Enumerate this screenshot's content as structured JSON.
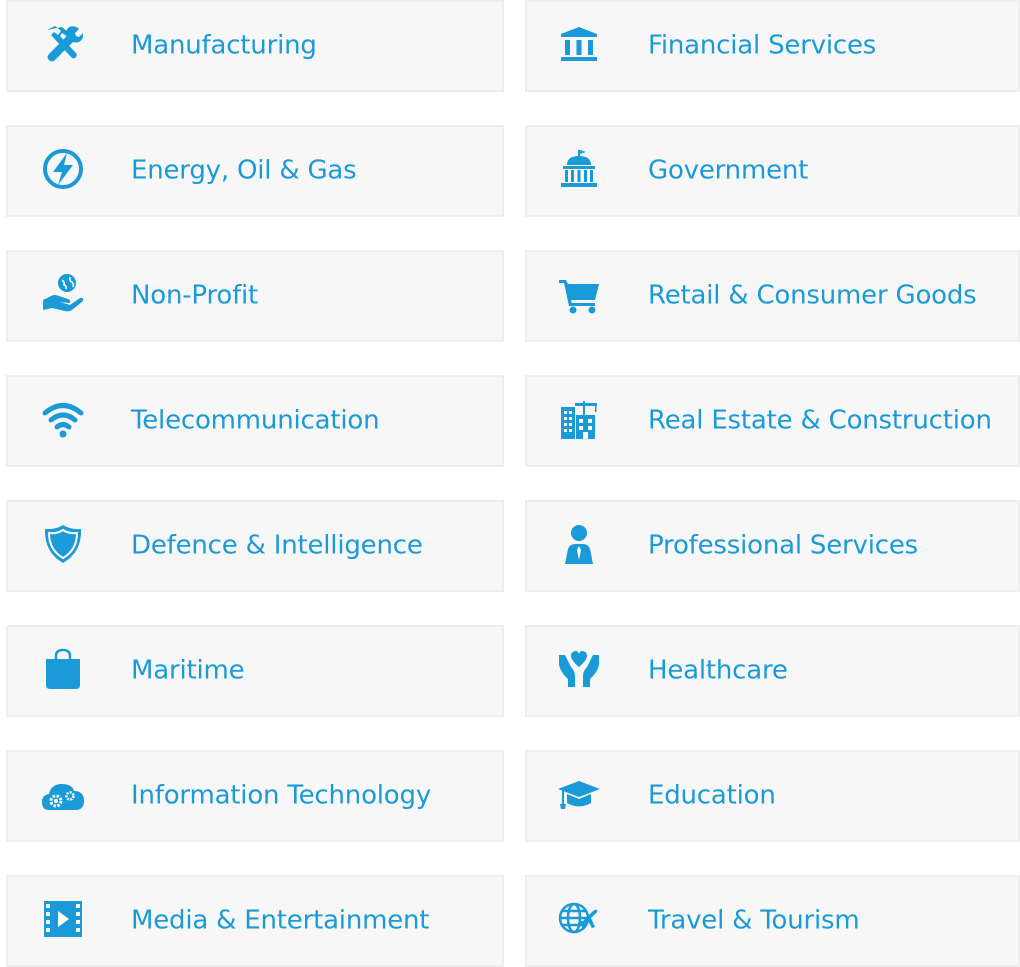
{
  "accent_color": "#1a9ad6",
  "card_background": "#f7f7f7",
  "industries": [
    {
      "label": "Manufacturing",
      "icon": "tools-icon"
    },
    {
      "label": "Financial Services",
      "icon": "bank-icon"
    },
    {
      "label": "Energy, Oil & Gas",
      "icon": "lightning-icon"
    },
    {
      "label": "Government",
      "icon": "government-building-icon"
    },
    {
      "label": "Non-Profit",
      "icon": "hand-globe-icon"
    },
    {
      "label": "Retail & Consumer Goods",
      "icon": "shopping-cart-icon"
    },
    {
      "label": "Telecommunication",
      "icon": "wifi-icon"
    },
    {
      "label": "Real Estate & Construction",
      "icon": "construction-building-icon"
    },
    {
      "label": "Defence & Intelligence",
      "icon": "shield-icon"
    },
    {
      "label": "Professional Services",
      "icon": "businessman-icon"
    },
    {
      "label": "Maritime",
      "icon": "bag-icon"
    },
    {
      "label": "Healthcare",
      "icon": "hands-heart-icon"
    },
    {
      "label": "Information Technology",
      "icon": "cloud-gears-icon"
    },
    {
      "label": "Education",
      "icon": "graduation-cap-icon"
    },
    {
      "label": "Media & Entertainment",
      "icon": "film-play-icon"
    },
    {
      "label": "Travel & Tourism",
      "icon": "globe-plane-icon"
    }
  ]
}
